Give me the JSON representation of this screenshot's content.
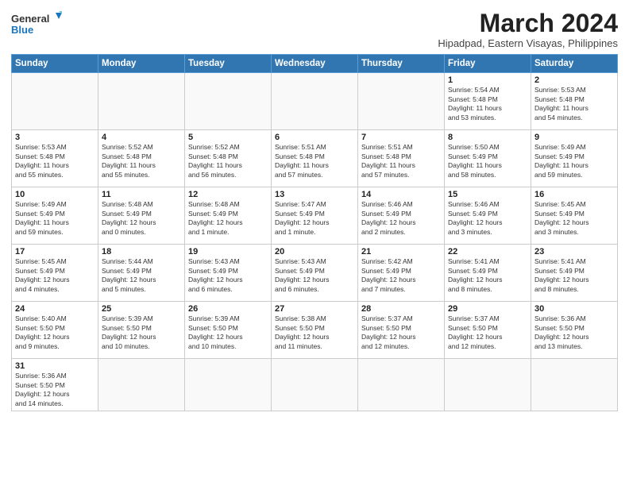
{
  "header": {
    "title": "March 2024",
    "subtitle": "Hipadpad, Eastern Visayas, Philippines",
    "logo_line1": "General",
    "logo_line2": "Blue"
  },
  "weekdays": [
    "Sunday",
    "Monday",
    "Tuesday",
    "Wednesday",
    "Thursday",
    "Friday",
    "Saturday"
  ],
  "weeks": [
    [
      {
        "day": "",
        "info": ""
      },
      {
        "day": "",
        "info": ""
      },
      {
        "day": "",
        "info": ""
      },
      {
        "day": "",
        "info": ""
      },
      {
        "day": "",
        "info": ""
      },
      {
        "day": "1",
        "info": "Sunrise: 5:54 AM\nSunset: 5:48 PM\nDaylight: 11 hours\nand 53 minutes."
      },
      {
        "day": "2",
        "info": "Sunrise: 5:53 AM\nSunset: 5:48 PM\nDaylight: 11 hours\nand 54 minutes."
      }
    ],
    [
      {
        "day": "3",
        "info": "Sunrise: 5:53 AM\nSunset: 5:48 PM\nDaylight: 11 hours\nand 55 minutes."
      },
      {
        "day": "4",
        "info": "Sunrise: 5:52 AM\nSunset: 5:48 PM\nDaylight: 11 hours\nand 55 minutes."
      },
      {
        "day": "5",
        "info": "Sunrise: 5:52 AM\nSunset: 5:48 PM\nDaylight: 11 hours\nand 56 minutes."
      },
      {
        "day": "6",
        "info": "Sunrise: 5:51 AM\nSunset: 5:48 PM\nDaylight: 11 hours\nand 57 minutes."
      },
      {
        "day": "7",
        "info": "Sunrise: 5:51 AM\nSunset: 5:48 PM\nDaylight: 11 hours\nand 57 minutes."
      },
      {
        "day": "8",
        "info": "Sunrise: 5:50 AM\nSunset: 5:49 PM\nDaylight: 11 hours\nand 58 minutes."
      },
      {
        "day": "9",
        "info": "Sunrise: 5:49 AM\nSunset: 5:49 PM\nDaylight: 11 hours\nand 59 minutes."
      }
    ],
    [
      {
        "day": "10",
        "info": "Sunrise: 5:49 AM\nSunset: 5:49 PM\nDaylight: 11 hours\nand 59 minutes."
      },
      {
        "day": "11",
        "info": "Sunrise: 5:48 AM\nSunset: 5:49 PM\nDaylight: 12 hours\nand 0 minutes."
      },
      {
        "day": "12",
        "info": "Sunrise: 5:48 AM\nSunset: 5:49 PM\nDaylight: 12 hours\nand 1 minute."
      },
      {
        "day": "13",
        "info": "Sunrise: 5:47 AM\nSunset: 5:49 PM\nDaylight: 12 hours\nand 1 minute."
      },
      {
        "day": "14",
        "info": "Sunrise: 5:46 AM\nSunset: 5:49 PM\nDaylight: 12 hours\nand 2 minutes."
      },
      {
        "day": "15",
        "info": "Sunrise: 5:46 AM\nSunset: 5:49 PM\nDaylight: 12 hours\nand 3 minutes."
      },
      {
        "day": "16",
        "info": "Sunrise: 5:45 AM\nSunset: 5:49 PM\nDaylight: 12 hours\nand 3 minutes."
      }
    ],
    [
      {
        "day": "17",
        "info": "Sunrise: 5:45 AM\nSunset: 5:49 PM\nDaylight: 12 hours\nand 4 minutes."
      },
      {
        "day": "18",
        "info": "Sunrise: 5:44 AM\nSunset: 5:49 PM\nDaylight: 12 hours\nand 5 minutes."
      },
      {
        "day": "19",
        "info": "Sunrise: 5:43 AM\nSunset: 5:49 PM\nDaylight: 12 hours\nand 6 minutes."
      },
      {
        "day": "20",
        "info": "Sunrise: 5:43 AM\nSunset: 5:49 PM\nDaylight: 12 hours\nand 6 minutes."
      },
      {
        "day": "21",
        "info": "Sunrise: 5:42 AM\nSunset: 5:49 PM\nDaylight: 12 hours\nand 7 minutes."
      },
      {
        "day": "22",
        "info": "Sunrise: 5:41 AM\nSunset: 5:49 PM\nDaylight: 12 hours\nand 8 minutes."
      },
      {
        "day": "23",
        "info": "Sunrise: 5:41 AM\nSunset: 5:49 PM\nDaylight: 12 hours\nand 8 minutes."
      }
    ],
    [
      {
        "day": "24",
        "info": "Sunrise: 5:40 AM\nSunset: 5:50 PM\nDaylight: 12 hours\nand 9 minutes."
      },
      {
        "day": "25",
        "info": "Sunrise: 5:39 AM\nSunset: 5:50 PM\nDaylight: 12 hours\nand 10 minutes."
      },
      {
        "day": "26",
        "info": "Sunrise: 5:39 AM\nSunset: 5:50 PM\nDaylight: 12 hours\nand 10 minutes."
      },
      {
        "day": "27",
        "info": "Sunrise: 5:38 AM\nSunset: 5:50 PM\nDaylight: 12 hours\nand 11 minutes."
      },
      {
        "day": "28",
        "info": "Sunrise: 5:37 AM\nSunset: 5:50 PM\nDaylight: 12 hours\nand 12 minutes."
      },
      {
        "day": "29",
        "info": "Sunrise: 5:37 AM\nSunset: 5:50 PM\nDaylight: 12 hours\nand 12 minutes."
      },
      {
        "day": "30",
        "info": "Sunrise: 5:36 AM\nSunset: 5:50 PM\nDaylight: 12 hours\nand 13 minutes."
      }
    ],
    [
      {
        "day": "31",
        "info": "Sunrise: 5:36 AM\nSunset: 5:50 PM\nDaylight: 12 hours\nand 14 minutes."
      },
      {
        "day": "",
        "info": ""
      },
      {
        "day": "",
        "info": ""
      },
      {
        "day": "",
        "info": ""
      },
      {
        "day": "",
        "info": ""
      },
      {
        "day": "",
        "info": ""
      },
      {
        "day": "",
        "info": ""
      }
    ]
  ]
}
